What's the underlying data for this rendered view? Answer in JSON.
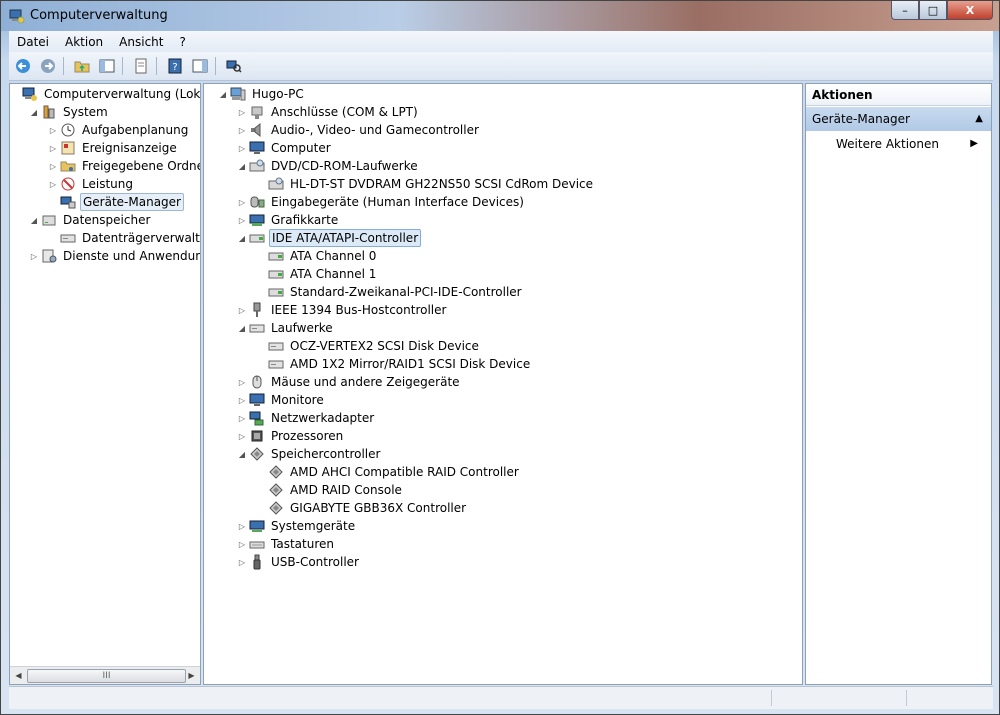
{
  "window": {
    "title": "Computerverwaltung",
    "minimize_glyph": "–",
    "maximize_glyph": "□",
    "close_glyph": "X"
  },
  "menu": [
    {
      "label": "Datei"
    },
    {
      "label": "Aktion"
    },
    {
      "label": "Ansicht"
    },
    {
      "label": "?"
    }
  ],
  "toolbar": [
    "back-icon",
    "forward-icon",
    "up-folder-icon",
    "show-hide-tree-icon",
    "export-list-icon",
    "help-icon",
    "show-hide-action-pane-icon",
    "scan-hardware-icon"
  ],
  "left_tree": [
    {
      "label": "Computerverwaltung (Lokal)",
      "level": 0,
      "icon": "computer-management-icon",
      "arrow": ""
    },
    {
      "label": "System",
      "level": 1,
      "icon": "system-tools-icon",
      "arrow": "◢"
    },
    {
      "label": "Aufgabenplanung",
      "level": 2,
      "icon": "clock-icon",
      "arrow": "▷"
    },
    {
      "label": "Ereignisanzeige",
      "level": 2,
      "icon": "event-viewer-icon",
      "arrow": "▷"
    },
    {
      "label": "Freigegebene Ordner",
      "level": 2,
      "icon": "shared-folder-icon",
      "arrow": "▷"
    },
    {
      "label": "Leistung",
      "level": 2,
      "icon": "performance-icon",
      "arrow": "▷"
    },
    {
      "label": "Geräte-Manager",
      "level": 2,
      "icon": "device-manager-icon",
      "arrow": "",
      "selected": true
    },
    {
      "label": "Datenspeicher",
      "level": 1,
      "icon": "storage-icon",
      "arrow": "◢"
    },
    {
      "label": "Datenträgerverwaltung",
      "level": 2,
      "icon": "disk-management-icon",
      "arrow": ""
    },
    {
      "label": "Dienste und Anwendungen",
      "level": 1,
      "icon": "services-icon",
      "arrow": "▷"
    }
  ],
  "left_scroll_thumb": "III",
  "device_tree": [
    {
      "label": "Hugo-PC",
      "level": 0,
      "icon": "computer-icon",
      "arrow": "◢"
    },
    {
      "label": "Anschlüsse (COM & LPT)",
      "level": 1,
      "icon": "port-icon",
      "arrow": "▷"
    },
    {
      "label": "Audio-, Video- und Gamecontroller",
      "level": 1,
      "icon": "speaker-icon",
      "arrow": "▷"
    },
    {
      "label": "Computer",
      "level": 1,
      "icon": "monitor-icon",
      "arrow": "▷"
    },
    {
      "label": "DVD/CD-ROM-Laufwerke",
      "level": 1,
      "icon": "dvd-drive-icon",
      "arrow": "◢"
    },
    {
      "label": "HL-DT-ST DVDRAM GH22NS50 SCSI CdRom Device",
      "level": 2,
      "icon": "dvd-drive-icon",
      "arrow": ""
    },
    {
      "label": "Eingabegeräte (Human Interface Devices)",
      "level": 1,
      "icon": "hid-icon",
      "arrow": "▷"
    },
    {
      "label": "Grafikkarte",
      "level": 1,
      "icon": "display-adapter-icon",
      "arrow": "▷"
    },
    {
      "label": "IDE ATA/ATAPI-Controller",
      "level": 1,
      "icon": "ide-controller-icon",
      "arrow": "◢",
      "focused": true
    },
    {
      "label": "ATA Channel 0",
      "level": 2,
      "icon": "ide-controller-icon",
      "arrow": ""
    },
    {
      "label": "ATA Channel 1",
      "level": 2,
      "icon": "ide-controller-icon",
      "arrow": ""
    },
    {
      "label": "Standard-Zweikanal-PCI-IDE-Controller",
      "level": 2,
      "icon": "ide-controller-icon",
      "arrow": ""
    },
    {
      "label": "IEEE 1394 Bus-Hostcontroller",
      "level": 1,
      "icon": "firewire-icon",
      "arrow": "▷"
    },
    {
      "label": "Laufwerke",
      "level": 1,
      "icon": "disk-drive-icon",
      "arrow": "◢"
    },
    {
      "label": "OCZ-VERTEX2 SCSI Disk Device",
      "level": 2,
      "icon": "disk-drive-icon",
      "arrow": ""
    },
    {
      "label": "AMD 1X2 Mirror/RAID1 SCSI Disk Device",
      "level": 2,
      "icon": "disk-drive-icon",
      "arrow": ""
    },
    {
      "label": "Mäuse und andere Zeigegeräte",
      "level": 1,
      "icon": "mouse-icon",
      "arrow": "▷"
    },
    {
      "label": "Monitore",
      "level": 1,
      "icon": "monitor-icon",
      "arrow": "▷"
    },
    {
      "label": "Netzwerkadapter",
      "level": 1,
      "icon": "network-adapter-icon",
      "arrow": "▷"
    },
    {
      "label": "Prozessoren",
      "level": 1,
      "icon": "processor-icon",
      "arrow": "▷"
    },
    {
      "label": "Speichercontroller",
      "level": 1,
      "icon": "storage-controller-icon",
      "arrow": "◢"
    },
    {
      "label": "AMD AHCI Compatible RAID Controller",
      "level": 2,
      "icon": "storage-controller-icon",
      "arrow": ""
    },
    {
      "label": "AMD RAID Console",
      "level": 2,
      "icon": "storage-controller-icon",
      "arrow": ""
    },
    {
      "label": "GIGABYTE GBB36X Controller",
      "level": 2,
      "icon": "storage-controller-icon",
      "arrow": ""
    },
    {
      "label": "Systemgeräte",
      "level": 1,
      "icon": "system-devices-icon",
      "arrow": "▷"
    },
    {
      "label": "Tastaturen",
      "level": 1,
      "icon": "keyboard-icon",
      "arrow": "▷"
    },
    {
      "label": "USB-Controller",
      "level": 1,
      "icon": "usb-icon",
      "arrow": "▷"
    }
  ],
  "actions": {
    "header": "Aktionen",
    "section": "Geräte-Manager",
    "section_glyph": "▲",
    "item": "Weitere Aktionen",
    "item_glyph": "▶"
  }
}
